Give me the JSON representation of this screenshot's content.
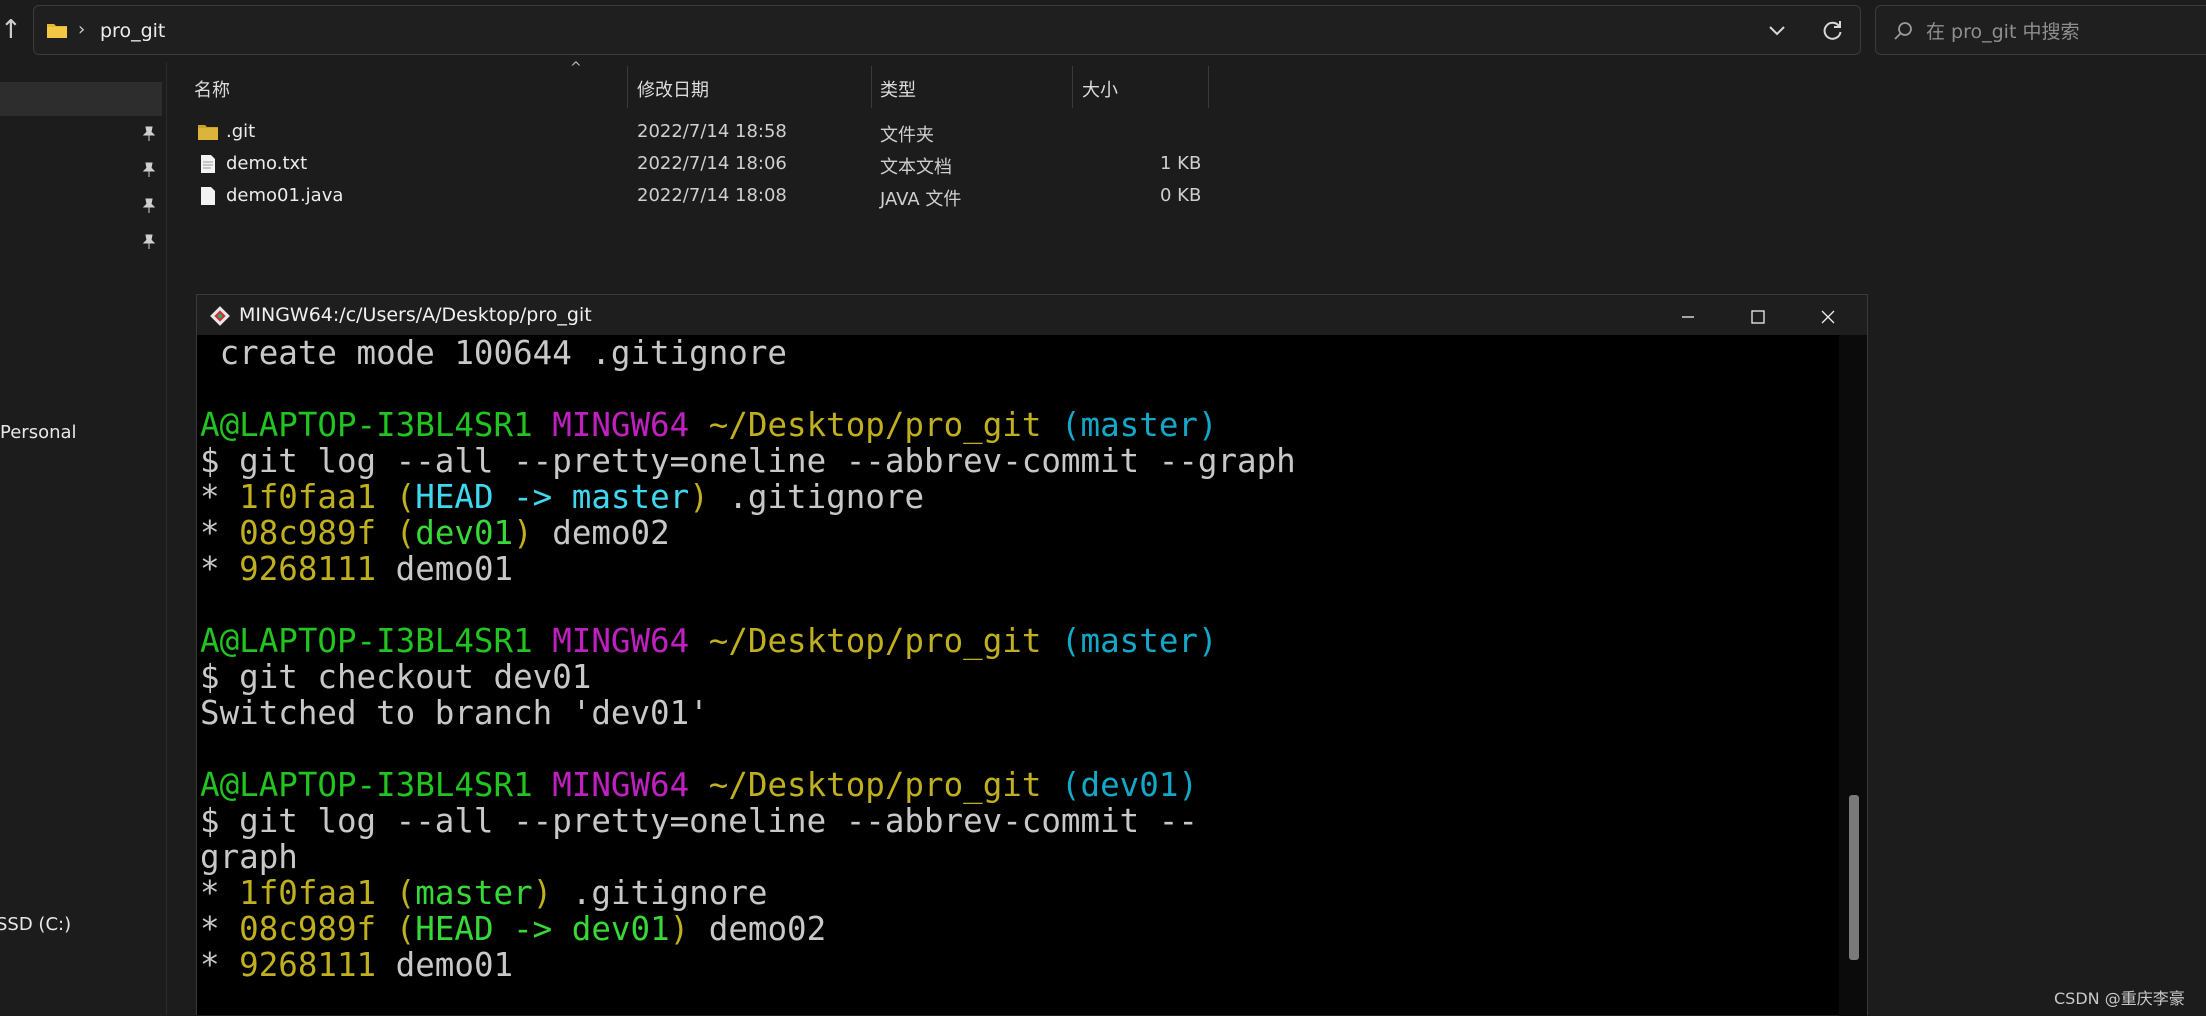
{
  "explorer": {
    "address": {
      "path": "pro_git",
      "separator": "›"
    },
    "search": {
      "placeholder": "在 pro_git 中搜索"
    },
    "columns": {
      "name": "名称",
      "modified": "修改日期",
      "type": "类型",
      "size": "大小"
    },
    "files": [
      {
        "name": ".git",
        "modified": "2022/7/14 18:58",
        "type": "文件夹",
        "size": "",
        "icon": "folder-icon"
      },
      {
        "name": "demo.txt",
        "modified": "2022/7/14 18:06",
        "type": "文本文档",
        "size": "1 KB",
        "icon": "text-file-icon"
      },
      {
        "name": "demo01.java",
        "modified": "2022/7/14 18:08",
        "type": "JAVA 文件",
        "size": "0 KB",
        "icon": "java-file-icon"
      }
    ],
    "nav": {
      "personal_label": "Personal",
      "drive_label": "SSD (C:)"
    }
  },
  "terminal": {
    "title": "MINGW64:/c/Users/A/Desktop/pro_git",
    "prompt": {
      "user": "A@LAPTOP-I3BL4SR1",
      "system": "MINGW64",
      "path": "~/Desktop/pro_git"
    },
    "lines": {
      "l0": " create mode 100644 .gitignore",
      "cmd1": "$ git log --all --pretty=oneline --abbrev-commit --graph",
      "branch1": "(master)",
      "g1_hash1": "1f0faa1",
      "g1_ref1": "HEAD -> master",
      "g1_msg1": " .gitignore",
      "g1_hash2": "08c989f",
      "g1_ref2": "dev01",
      "g1_msg2": " demo02",
      "g1_hash3": "9268111",
      "g1_msg3": " demo01",
      "cmd2": "$ git checkout dev01",
      "out2": "Switched to branch 'dev01'",
      "branch3": "(dev01)",
      "cmd3a": "$ git log --all --pretty=oneline --abbrev-commit --",
      "cmd3b": "graph",
      "g2_hash1": "1f0faa1",
      "g2_ref1": "master",
      "g2_msg1": " .gitignore",
      "g2_hash2": "08c989f",
      "g2_ref2": "HEAD -> dev01",
      "g2_msg2": " demo02",
      "g2_hash3": "9268111",
      "g2_msg3": " demo01"
    },
    "colors": {
      "user": "#22c422",
      "system": "#c020c0",
      "path": "#c0b020",
      "branch": "#14a8c8",
      "head": "#40d8f0"
    }
  },
  "watermark": "CSDN @重庆李豪"
}
